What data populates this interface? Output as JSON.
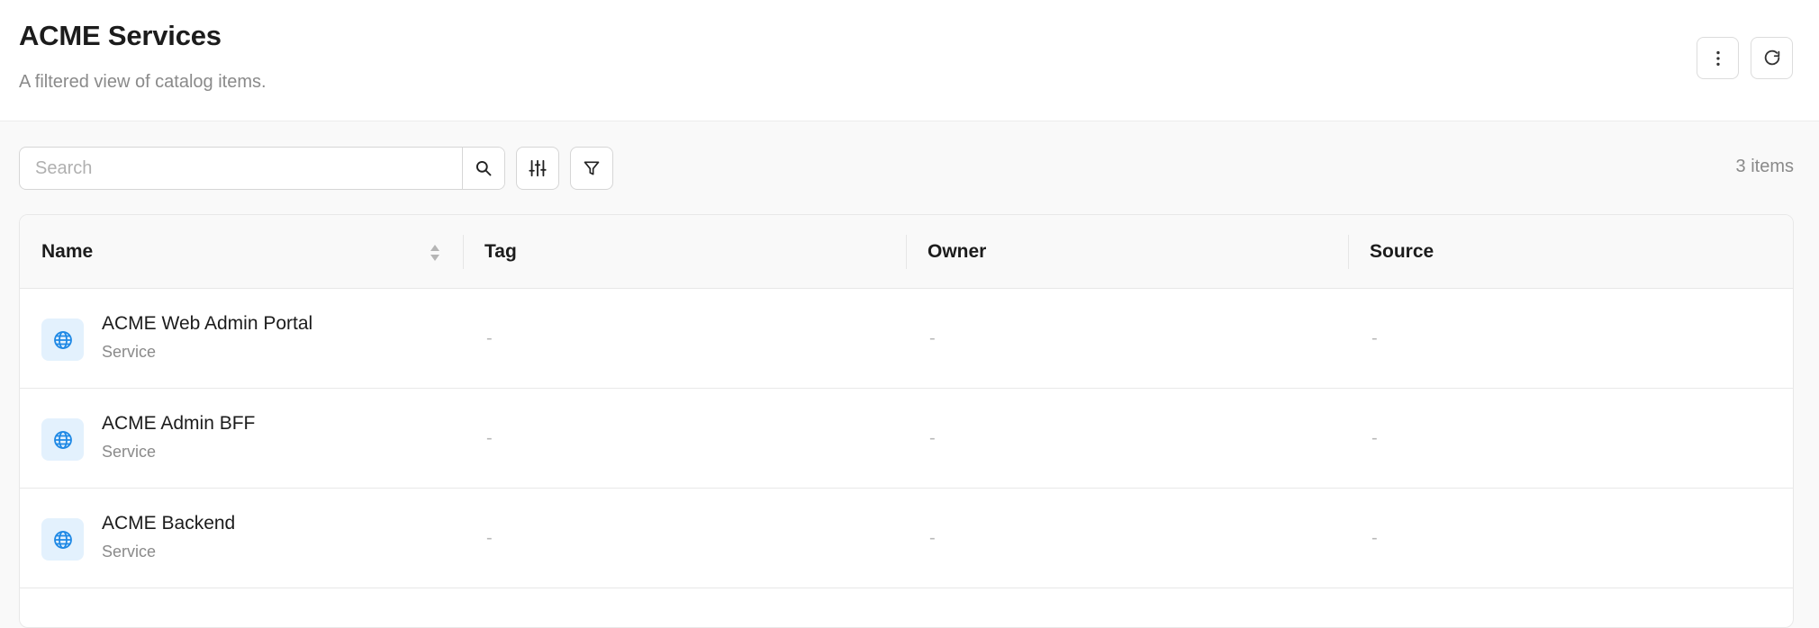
{
  "header": {
    "title": "ACME Services",
    "subtitle": "A filtered view of catalog items.",
    "more_icon": "more-vertical-icon",
    "refresh_icon": "refresh-icon"
  },
  "toolbar": {
    "search_placeholder": "Search",
    "search_value": "",
    "search_icon": "search-icon",
    "columns_icon": "sliders-icon",
    "filter_icon": "filter-icon",
    "item_count": "3 items"
  },
  "table": {
    "columns": [
      "Name",
      "Tag",
      "Owner",
      "Source"
    ],
    "sort_icon": "sort-icon",
    "rows": [
      {
        "name": "ACME Web Admin Portal",
        "kind": "Service",
        "icon": "globe-icon",
        "tag": "-",
        "owner": "-",
        "source": "-"
      },
      {
        "name": "ACME Admin BFF",
        "kind": "Service",
        "icon": "globe-icon",
        "tag": "-",
        "owner": "-",
        "source": "-"
      },
      {
        "name": "ACME Backend",
        "kind": "Service",
        "icon": "globe-icon",
        "tag": "-",
        "owner": "-",
        "source": "-"
      }
    ]
  },
  "colors": {
    "icon_blue": "#1e88e5",
    "icon_bg": "#e3f1fd",
    "muted_text": "#8a8a8a"
  }
}
